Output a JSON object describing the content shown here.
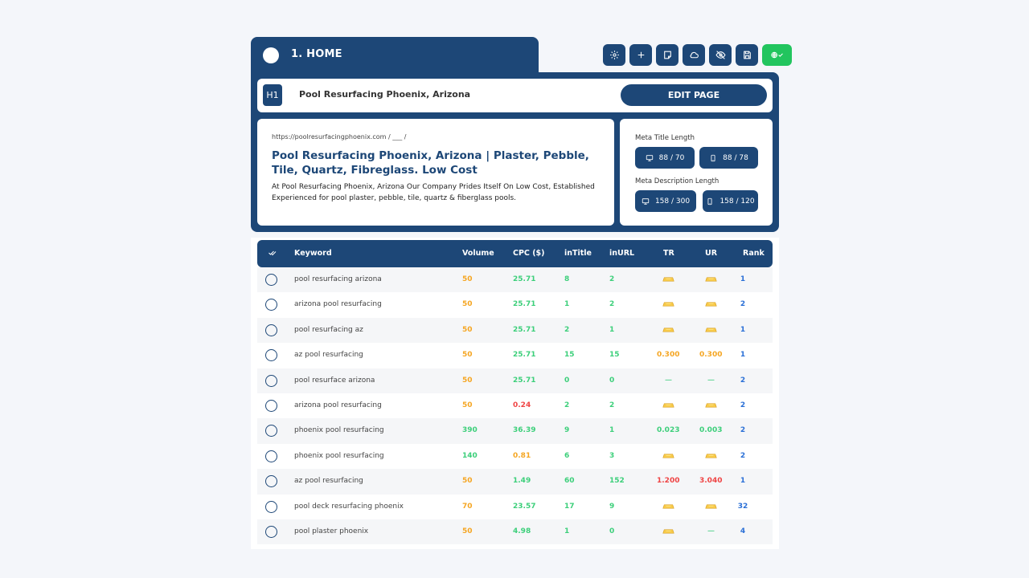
{
  "header": {
    "title": "1. HOME"
  },
  "toolbar": {
    "icons": [
      "gear-icon",
      "plus-icon",
      "note-icon",
      "cloud-icon",
      "eye-off-icon",
      "save-icon",
      "globe-check-icon"
    ]
  },
  "h1": {
    "badge": "H1",
    "text": "Pool Resurfacing Phoenix, Arizona",
    "edit_label": "EDIT PAGE"
  },
  "serp": {
    "url": "https://poolresurfacingphoenix.com  /  ___  /",
    "title": "Pool Resurfacing Phoenix, Arizona | Plaster, Pebble, Tile, Quartz, Fibreglass.  Low Cost",
    "description": "At Pool Resurfacing Phoenix, Arizona Our Company Prides Itself On Low Cost, Established Experienced for pool plaster, pebble, tile, quartz & fiberglass pools."
  },
  "meta": {
    "title_label": "Meta Title Length",
    "title_desktop": "88 / 70",
    "title_mobile": "88 / 78",
    "desc_label": "Meta Description Length",
    "desc_desktop": "158 / 300",
    "desc_mobile": "158 / 120"
  },
  "table": {
    "headers": {
      "keyword": "Keyword",
      "volume": "Volume",
      "cpc": "CPC ($)",
      "intitle": "inTitle",
      "inurl": "inURL",
      "tr": "TR",
      "ur": "UR",
      "rank": "Rank"
    },
    "rows": [
      {
        "keyword": "pool resurfacing arizona",
        "volume": "50",
        "cpc": "25.71",
        "intitle": "8",
        "inurl": "2",
        "tr": "gold",
        "ur": "gold",
        "rank": "1"
      },
      {
        "keyword": "arizona pool resurfacing",
        "volume": "50",
        "cpc": "25.71",
        "intitle": "1",
        "inurl": "2",
        "tr": "gold",
        "ur": "gold",
        "rank": "2"
      },
      {
        "keyword": "pool resurfacing az",
        "volume": "50",
        "cpc": "25.71",
        "intitle": "2",
        "inurl": "1",
        "tr": "gold",
        "ur": "gold",
        "rank": "1"
      },
      {
        "keyword": "az pool resurfacing",
        "volume": "50",
        "cpc": "25.71",
        "intitle": "15",
        "inurl": "15",
        "tr": "0.300",
        "ur": "0.300",
        "rank": "1"
      },
      {
        "keyword": "pool resurface arizona",
        "volume": "50",
        "cpc": "25.71",
        "intitle": "0",
        "inurl": "0",
        "tr": "—",
        "ur": "—",
        "rank": "2"
      },
      {
        "keyword": "arizona pool resurfacing",
        "volume": "50",
        "cpc": "0.24",
        "intitle": "2",
        "inurl": "2",
        "tr": "gold",
        "ur": "gold",
        "rank": "2"
      },
      {
        "keyword": "phoenix pool resurfacing",
        "volume": "390",
        "cpc": "36.39",
        "intitle": "9",
        "inurl": "1",
        "tr": "0.023",
        "ur": "0.003",
        "rank": "2"
      },
      {
        "keyword": "phoenix pool resurfacing",
        "volume": "140",
        "cpc": "0.81",
        "intitle": "6",
        "inurl": "3",
        "tr": "gold",
        "ur": "gold",
        "rank": "2"
      },
      {
        "keyword": "az pool resurfacing",
        "volume": "50",
        "cpc": "1.49",
        "intitle": "60",
        "inurl": "152",
        "tr": "1.200",
        "ur": "3.040",
        "rank": "1"
      },
      {
        "keyword": "pool deck resurfacing phoenix",
        "volume": "70",
        "cpc": "23.57",
        "intitle": "17",
        "inurl": "9",
        "tr": "gold",
        "ur": "gold",
        "rank": "32"
      },
      {
        "keyword": "pool plaster phoenix",
        "volume": "50",
        "cpc": "4.98",
        "intitle": "1",
        "inurl": "0",
        "tr": "gold",
        "ur": "—",
        "rank": "4"
      }
    ]
  }
}
